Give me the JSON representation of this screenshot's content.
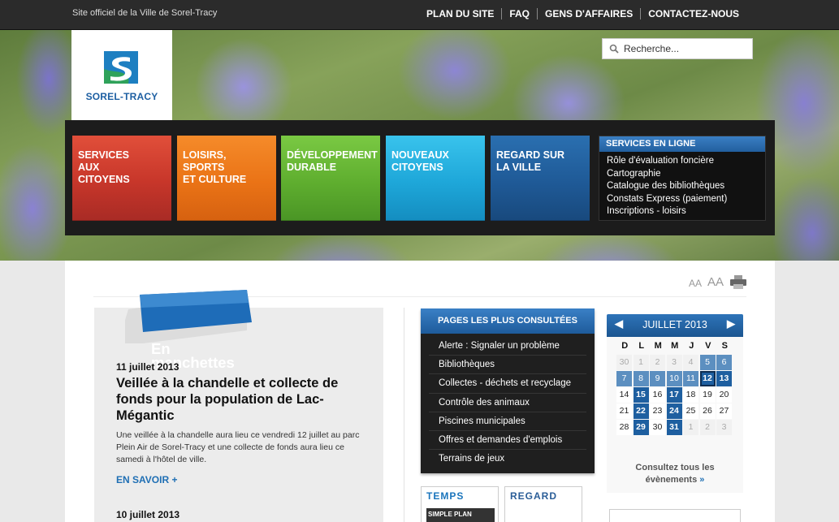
{
  "header": {
    "official_text": "Site officiel de la Ville de Sorel-Tracy",
    "links": [
      "PLAN DU SITE",
      "FAQ",
      "GENS D'AFFAIRES",
      "CONTACTEZ-NOUS"
    ]
  },
  "logo": {
    "text": "SOREL-TRACY"
  },
  "search": {
    "placeholder": "Recherche..."
  },
  "nav": {
    "tiles": [
      "SERVICES\nAUX\nCITOYENS",
      "LOISIRS,\nSPORTS\nET CULTURE",
      "DÉVELOPPEMENT\nDURABLE",
      "NOUVEAUX\nCITOYENS",
      "REGARD SUR\nLA VILLE"
    ],
    "services": {
      "title": "SERVICES EN LIGNE",
      "items": [
        "Rôle d'évaluation foncière",
        "Cartographie",
        "Catalogue des bibliothèques",
        "Constats Express (paiement)",
        "Inscriptions - loisirs"
      ]
    }
  },
  "tools": {
    "small": "AA",
    "large": "AA"
  },
  "news": {
    "badge": [
      "En",
      "manchettes"
    ],
    "items": [
      {
        "date": "11 juillet 2013",
        "title": "Veillée à la chandelle et collecte de fonds pour la population de Lac-Mégantic",
        "body": "Une veillée à la chandelle aura lieu ce vendredi 12 juillet au parc Plein Air de Sorel-Tracy et une collecte de fonds aura lieu ce samedi à l'hôtel de ville.",
        "more": "EN SAVOIR +"
      },
      {
        "date": "10 juillet 2013"
      }
    ]
  },
  "popular": {
    "title": "PAGES LES PLUS CONSULTÉES",
    "items": [
      "Alerte : Signaler un problème",
      "Bibliothèques",
      "Collectes - déchets et recyclage",
      "Contrôle des animaux",
      "Piscines municipales",
      "Offres et demandes d'emplois",
      "Terrains de jeux"
    ]
  },
  "thumbs": [
    {
      "title": "TEMPS",
      "label": "SIMPLE PLAN"
    },
    {
      "title": "REGARD",
      "label": ""
    }
  ],
  "calendar": {
    "month": "JUILLET 2013",
    "prev": "◀",
    "next": "▶",
    "weekdays": [
      "D",
      "L",
      "M",
      "M",
      "J",
      "V",
      "S"
    ],
    "cells": [
      {
        "d": "30",
        "s": "off"
      },
      {
        "d": "1",
        "s": "off"
      },
      {
        "d": "2",
        "s": "off"
      },
      {
        "d": "3",
        "s": "off"
      },
      {
        "d": "4",
        "s": "off"
      },
      {
        "d": "5",
        "s": "wk"
      },
      {
        "d": "6",
        "s": "wk"
      },
      {
        "d": "7",
        "s": "wk"
      },
      {
        "d": "8",
        "s": "wk"
      },
      {
        "d": "9",
        "s": "wk"
      },
      {
        "d": "10",
        "s": "wk"
      },
      {
        "d": "11",
        "s": "wk"
      },
      {
        "d": "12",
        "s": "today"
      },
      {
        "d": "13",
        "s": "ev"
      },
      {
        "d": "14",
        "s": ""
      },
      {
        "d": "15",
        "s": "ev"
      },
      {
        "d": "16",
        "s": ""
      },
      {
        "d": "17",
        "s": "ev"
      },
      {
        "d": "18",
        "s": ""
      },
      {
        "d": "19",
        "s": ""
      },
      {
        "d": "20",
        "s": ""
      },
      {
        "d": "21",
        "s": ""
      },
      {
        "d": "22",
        "s": "ev"
      },
      {
        "d": "23",
        "s": ""
      },
      {
        "d": "24",
        "s": "ev"
      },
      {
        "d": "25",
        "s": ""
      },
      {
        "d": "26",
        "s": ""
      },
      {
        "d": "27",
        "s": ""
      },
      {
        "d": "28",
        "s": ""
      },
      {
        "d": "29",
        "s": "ev"
      },
      {
        "d": "30",
        "s": ""
      },
      {
        "d": "31",
        "s": "ev"
      },
      {
        "d": "1",
        "s": "off"
      },
      {
        "d": "2",
        "s": "off"
      },
      {
        "d": "3",
        "s": "off"
      }
    ],
    "footer_line1": "Consultez tous les",
    "footer_line2": "évènements",
    "footer_arrow": "»"
  },
  "colors": {
    "brand_blue": "#1d5fa2",
    "tile_red": "#c7362a",
    "tile_orange": "#ea7316",
    "tile_green": "#5fae2f",
    "tile_cyan": "#1ea7d9",
    "tile_blue": "#1f5a97"
  }
}
